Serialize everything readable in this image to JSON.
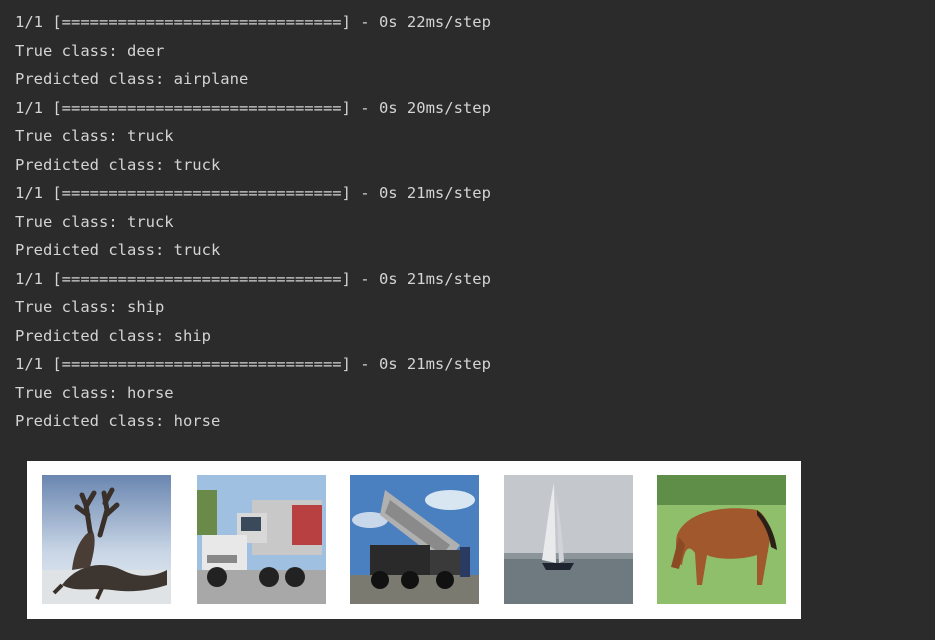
{
  "log": [
    {
      "progress": "1/1 [==============================] - 0s 22ms/step",
      "true_class": "True class: deer",
      "predicted_class": "Predicted class: airplane"
    },
    {
      "progress": "1/1 [==============================] - 0s 20ms/step",
      "true_class": "True class: truck",
      "predicted_class": "Predicted class: truck"
    },
    {
      "progress": "1/1 [==============================] - 0s 21ms/step",
      "true_class": "True class: truck",
      "predicted_class": "Predicted class: truck"
    },
    {
      "progress": "1/1 [==============================] - 0s 21ms/step",
      "true_class": "True class: ship",
      "predicted_class": "Predicted class: ship"
    },
    {
      "progress": "1/1 [==============================] - 0s 21ms/step",
      "true_class": "True class: horse",
      "predicted_class": "Predicted class: horse"
    }
  ],
  "colors": {
    "background": "#2b2b2b",
    "text": "#d4d4d4",
    "figure_background": "#ffffff"
  }
}
